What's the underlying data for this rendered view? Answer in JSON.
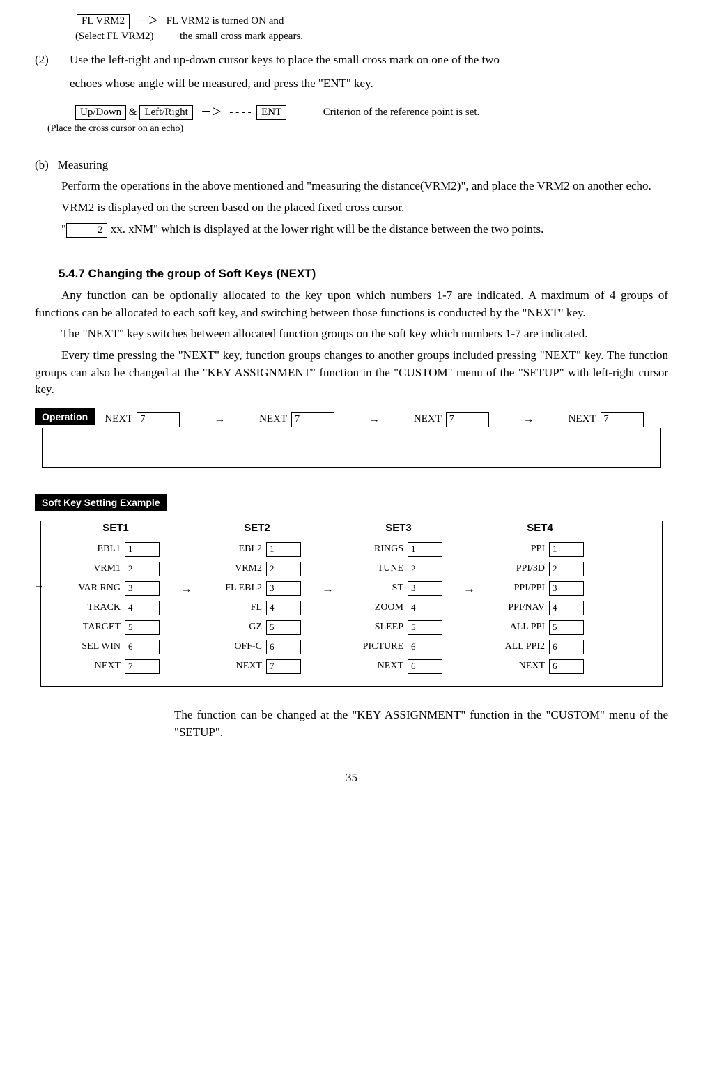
{
  "top": {
    "flvrm2_key": "FL VRM2",
    "dash_arrow": "－＞",
    "flvrm2_on": "FL VRM2 is turned ON and",
    "select_flvrm2": "(Select FL VRM2)",
    "small_cross": "the small cross mark appears."
  },
  "step2": {
    "num": "(2)",
    "text1": "Use the left-right and up-down cursor keys to place the small cross mark on one of the two",
    "text2": "echoes whose angle will be measured, and press the \"ENT\" key."
  },
  "diagram2": {
    "updown_key": "Up/Down",
    "amp": " & ",
    "leftright_key": "Left/Right",
    "dash_arrow": "－＞",
    "dashes": "- - - -",
    "ent_key": "ENT",
    "criterion": "Criterion of the reference point is set.",
    "place_note": "(Place the cross cursor on an echo)"
  },
  "sectionB": {
    "label": "(b)",
    "title": "Measuring",
    "p1": "Perform the operations in the above mentioned and \"measuring the distance(VRM2)\", and place the VRM2   on another echo.",
    "p2": "VRM2 is displayed on the screen based on the placed fixed cross cursor.",
    "p3a": "\"",
    "key2": " 2 ",
    "p3b": " xx. xNM\" which is displayed at the lower right will be the distance between the two points."
  },
  "s547": {
    "heading": "5.4.7 Changing the group of Soft Keys (NEXT)",
    "p1": "Any function can be optionally allocated to the key upon which numbers 1-7 are indicated.   A maximum of 4 groups of functions can be allocated to each soft key, and switching between those functions is conducted by the \"NEXT\" key.",
    "p2": "The \"NEXT\" key switches between allocated function groups on the soft key which numbers 1-7 are indicated.",
    "p3": "Every time pressing the \"NEXT\" key, function groups changes to another groups included pressing \"NEXT\" key. The function groups can also be changed at the \"KEY ASSIGNMENT\" function in the \"CUSTOM\" menu of the \"SETUP\" with left-right cursor key.",
    "operation": "Operation"
  },
  "nextflow": {
    "next": "NEXT",
    "n": "7",
    "arrow": "→"
  },
  "softkey": {
    "label": "Soft Key Setting Example",
    "arrow": "→",
    "sets": [
      {
        "head": "SET1",
        "rows": [
          {
            "l": "EBL1",
            "n": "1"
          },
          {
            "l": "VRM1",
            "n": "2"
          },
          {
            "l": "VAR RNG",
            "n": "3"
          },
          {
            "l": "TRACK",
            "n": "4"
          },
          {
            "l": "TARGET",
            "n": "5"
          },
          {
            "l": "SEL WIN",
            "n": "6"
          },
          {
            "l": "NEXT",
            "n": "7"
          }
        ]
      },
      {
        "head": "SET2",
        "rows": [
          {
            "l": "EBL2",
            "n": "1"
          },
          {
            "l": "VRM2",
            "n": "2"
          },
          {
            "l": "FL EBL2",
            "n": "3"
          },
          {
            "l": "FL",
            "n": "4"
          },
          {
            "l": "GZ",
            "n": "5"
          },
          {
            "l": "OFF-C",
            "n": "6"
          },
          {
            "l": "NEXT",
            "n": "7"
          }
        ]
      },
      {
        "head": "SET3",
        "rows": [
          {
            "l": "RINGS",
            "n": "1"
          },
          {
            "l": "TUNE",
            "n": "2"
          },
          {
            "l": "ST",
            "n": "3"
          },
          {
            "l": "ZOOM",
            "n": "4"
          },
          {
            "l": "SLEEP",
            "n": "5"
          },
          {
            "l": "PICTURE",
            "n": "6"
          },
          {
            "l": "NEXT",
            "n": "6"
          }
        ]
      },
      {
        "head": "SET4",
        "rows": [
          {
            "l": "PPI",
            "n": "1"
          },
          {
            "l": "PPI/3D",
            "n": "2"
          },
          {
            "l": "PPI/PPI",
            "n": "3"
          },
          {
            "l": "PPI/NAV",
            "n": "4"
          },
          {
            "l": "ALL PPI",
            "n": "5"
          },
          {
            "l": "ALL PPI2",
            "n": "6"
          },
          {
            "l": "NEXT",
            "n": "6"
          }
        ]
      }
    ]
  },
  "footnote": "The function can be changed at the \"KEY ASSIGNMENT\" function in the \"CUSTOM\" menu of the \"SETUP\".",
  "page": "35"
}
